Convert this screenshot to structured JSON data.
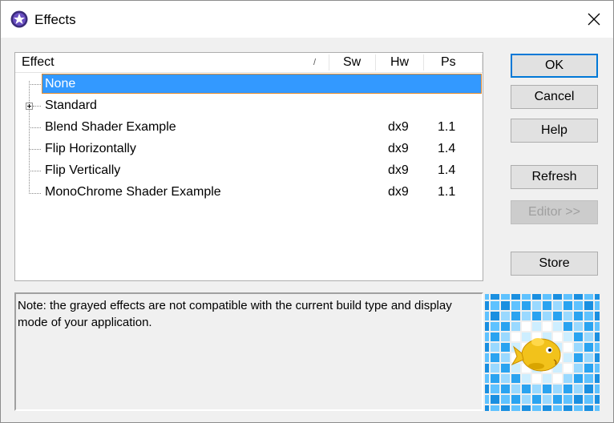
{
  "window": {
    "title": "Effects",
    "icon": "effects-app-icon",
    "close_icon": "close-icon"
  },
  "list": {
    "columns": [
      "Effect",
      "Sw",
      "Hw",
      "Ps"
    ],
    "sort_indicator": "/",
    "rows": [
      {
        "name": "None",
        "sw": "",
        "hw": "",
        "ps": "",
        "selected": true
      },
      {
        "name": "Standard",
        "sw": "",
        "hw": "",
        "ps": "",
        "expandable": true
      },
      {
        "name": "Blend Shader Example",
        "sw": "",
        "hw": "dx9",
        "ps": "1.1"
      },
      {
        "name": "Flip Horizontally",
        "sw": "",
        "hw": "dx9",
        "ps": "1.4"
      },
      {
        "name": "Flip Vertically",
        "sw": "",
        "hw": "dx9",
        "ps": "1.4"
      },
      {
        "name": "MonoChrome Shader Example",
        "sw": "",
        "hw": "dx9",
        "ps": "1.1"
      }
    ]
  },
  "buttons": {
    "ok": "OK",
    "cancel": "Cancel",
    "help": "Help",
    "refresh": "Refresh",
    "editor": "Editor >>",
    "store": "Store"
  },
  "note": "Note: the grayed effects are not compatible with the current build type and display mode of your application.",
  "preview": {
    "subject": "yellow-fish",
    "background": "blue-checker-tiles"
  },
  "colors": {
    "selection": "#3399ff",
    "selection_border": "#e38b2e",
    "default_button_border": "#0078d7",
    "disabled_text": "#a0a0a0"
  }
}
